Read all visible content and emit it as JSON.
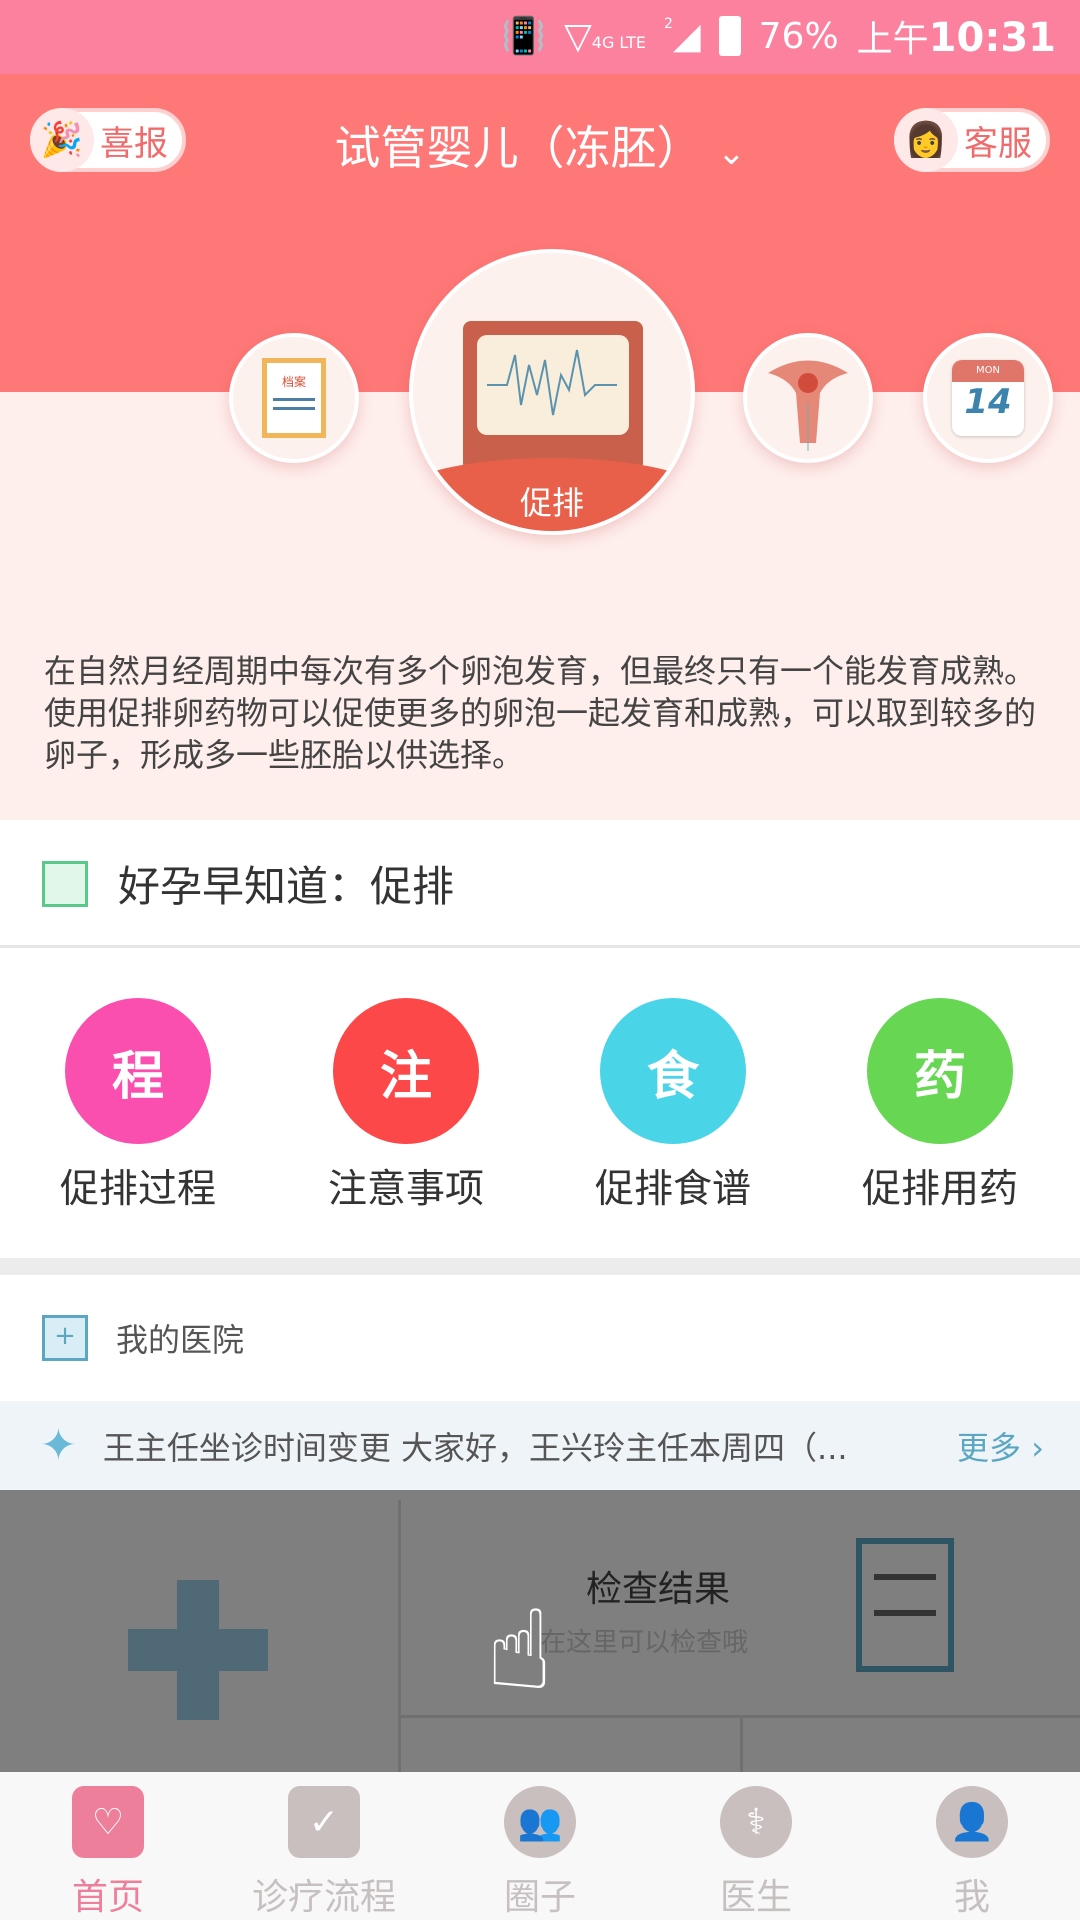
{
  "status_bar": {
    "battery": "76%",
    "time_prefix": "上午",
    "time": "10:31",
    "network": "4G LTE",
    "sim": "2"
  },
  "header": {
    "left_button": "喜报",
    "title": "试管婴儿（冻胚）",
    "right_button": "客服"
  },
  "stages": [
    {
      "icon": "archive-clipboard-icon",
      "label": "档案"
    },
    {
      "icon": "monitor-icon",
      "label": "促排"
    },
    {
      "icon": "uterus-icon"
    },
    {
      "icon": "calendar-icon",
      "day": "MON",
      "date": "14"
    }
  ],
  "description": "在自然月经周期中每次有多个卵泡发育，但最终只有一个能发育成熟。使用促排卵药物可以促使更多的卵泡一起发育和成熟，可以取到较多的卵子，形成多一些胚胎以供选择。",
  "tip_title": "好孕早知道：促排",
  "quick_links": [
    {
      "glyph": "程",
      "label": "促排过程",
      "color": "#FB4FB0"
    },
    {
      "glyph": "注",
      "label": "注意事项",
      "color": "#FC4849"
    },
    {
      "glyph": "食",
      "label": "促排食谱",
      "color": "#49D4E8"
    },
    {
      "glyph": "药",
      "label": "促排用药",
      "color": "#66D653"
    }
  ],
  "hospital": {
    "title": "我的医院",
    "notice": "王主任坐诊时间变更 大家好，王兴玲主任本周四（...",
    "more": "更多"
  },
  "overlay": {
    "card_title": "检查结果",
    "card_sub": "在这里可以检查哦"
  },
  "tabs": [
    {
      "label": "首页",
      "active": true
    },
    {
      "label": "诊疗流程"
    },
    {
      "label": "圈子"
    },
    {
      "label": "医生"
    },
    {
      "label": "我"
    }
  ]
}
